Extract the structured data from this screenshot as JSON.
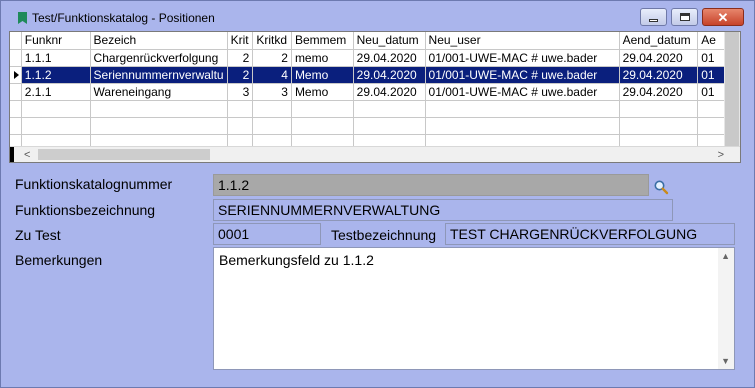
{
  "window": {
    "title": "Test/Funktionskatalog - Positionen",
    "icon": "bookmark-icon",
    "buttons": [
      "minimize",
      "maximize",
      "close"
    ],
    "close_glyph": "✕"
  },
  "grid": {
    "columns": [
      "Funknr",
      "Bezeich",
      "Krit",
      "Kritkd",
      "Bemmem",
      "Neu_datum",
      "Neu_user",
      "Aend_datum",
      "Ae"
    ],
    "rows": [
      [
        "1.1.1",
        "Chargenrückverfolgung",
        "2",
        "2",
        "memo",
        "29.04.2020",
        "01/001-UWE-MAC # uwe.bader",
        "29.04.2020",
        "01"
      ],
      [
        "1.1.2",
        "Seriennummernverwaltu",
        "2",
        "4",
        "Memo",
        "29.04.2020",
        "01/001-UWE-MAC # uwe.bader",
        "29.04.2020",
        "01"
      ],
      [
        "2.1.1",
        "Wareneingang",
        "3",
        "3",
        "Memo",
        "29.04.2020",
        "01/001-UWE-MAC # uwe.bader",
        "29.04.2020",
        "01"
      ]
    ],
    "selected_row": 1,
    "empty_rows": 3,
    "scroll_left_glyph": "<",
    "scroll_right_glyph": ">"
  },
  "form": {
    "katalognummer_label": "Funktionskatalognummer",
    "katalognummer_value": "1.1.2",
    "bezeichnung_label": "Funktionsbezeichnung",
    "bezeichnung_value": "SERIENNUMMERNVERWALTUNG",
    "zutest_label": "Zu Test",
    "zutest_value": "0001",
    "testbez_label": "Testbezeichnung",
    "testbez_value": "TEST CHARGENRÜCKVERFOLGUNG",
    "bemerkungen_label": "Bemerkungen",
    "bemerkungen_value": "Bemerkungsfeld zu 1.1.2",
    "search_icon": "magnifier-icon"
  },
  "colors": {
    "background": "#aab5ec",
    "selection": "#0a1f7d",
    "readonly": "#a8a8a8"
  }
}
